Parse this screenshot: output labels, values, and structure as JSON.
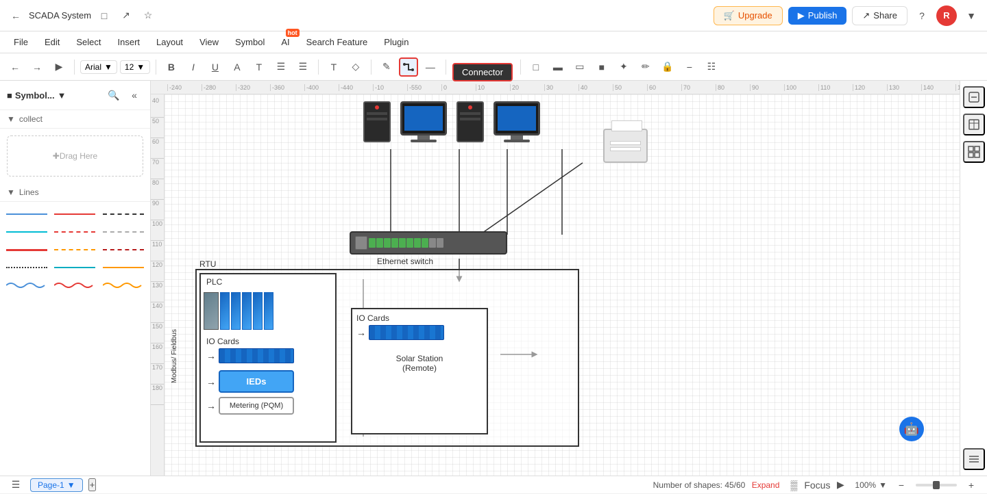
{
  "app": {
    "title": "SCADA System",
    "icons": [
      "back-arrow",
      "history",
      "book",
      "star"
    ]
  },
  "topbar": {
    "upgrade_label": "Upgrade",
    "publish_label": "Publish",
    "share_label": "Share",
    "avatar_letter": "R"
  },
  "menubar": {
    "items": [
      "File",
      "Edit",
      "Select",
      "Insert",
      "Layout",
      "View",
      "Symbol",
      "AI",
      "Search Feature",
      "Plugin"
    ],
    "ai_hot": "hot"
  },
  "toolbar": {
    "font": "Arial",
    "font_size": "12",
    "connector_label": "Connector"
  },
  "sidebar": {
    "title": "Symbol...",
    "section_collect": "collect",
    "section_lines": "Lines",
    "drag_placeholder": "Drag Here"
  },
  "diagram": {
    "ethernet_switch_label": "Ethernet switch",
    "rtu_label": "RTU",
    "plc_label": "PLC",
    "io_cards_inner_label": "IO Cards",
    "ieds_label": "IEDs",
    "metering_label": "Metering (PQM)",
    "remote_station_label": "Solar Station\n(Remote)",
    "remote_io_label": "IO Cards",
    "modbus_label": "Modbus/ Fieldbus"
  },
  "statusbar": {
    "page_label": "Page-1",
    "shapes_count": "Number of shapes: 45/60",
    "expand_label": "Expand",
    "focus_label": "Focus",
    "zoom_level": "100%",
    "add_page_label": "+"
  }
}
